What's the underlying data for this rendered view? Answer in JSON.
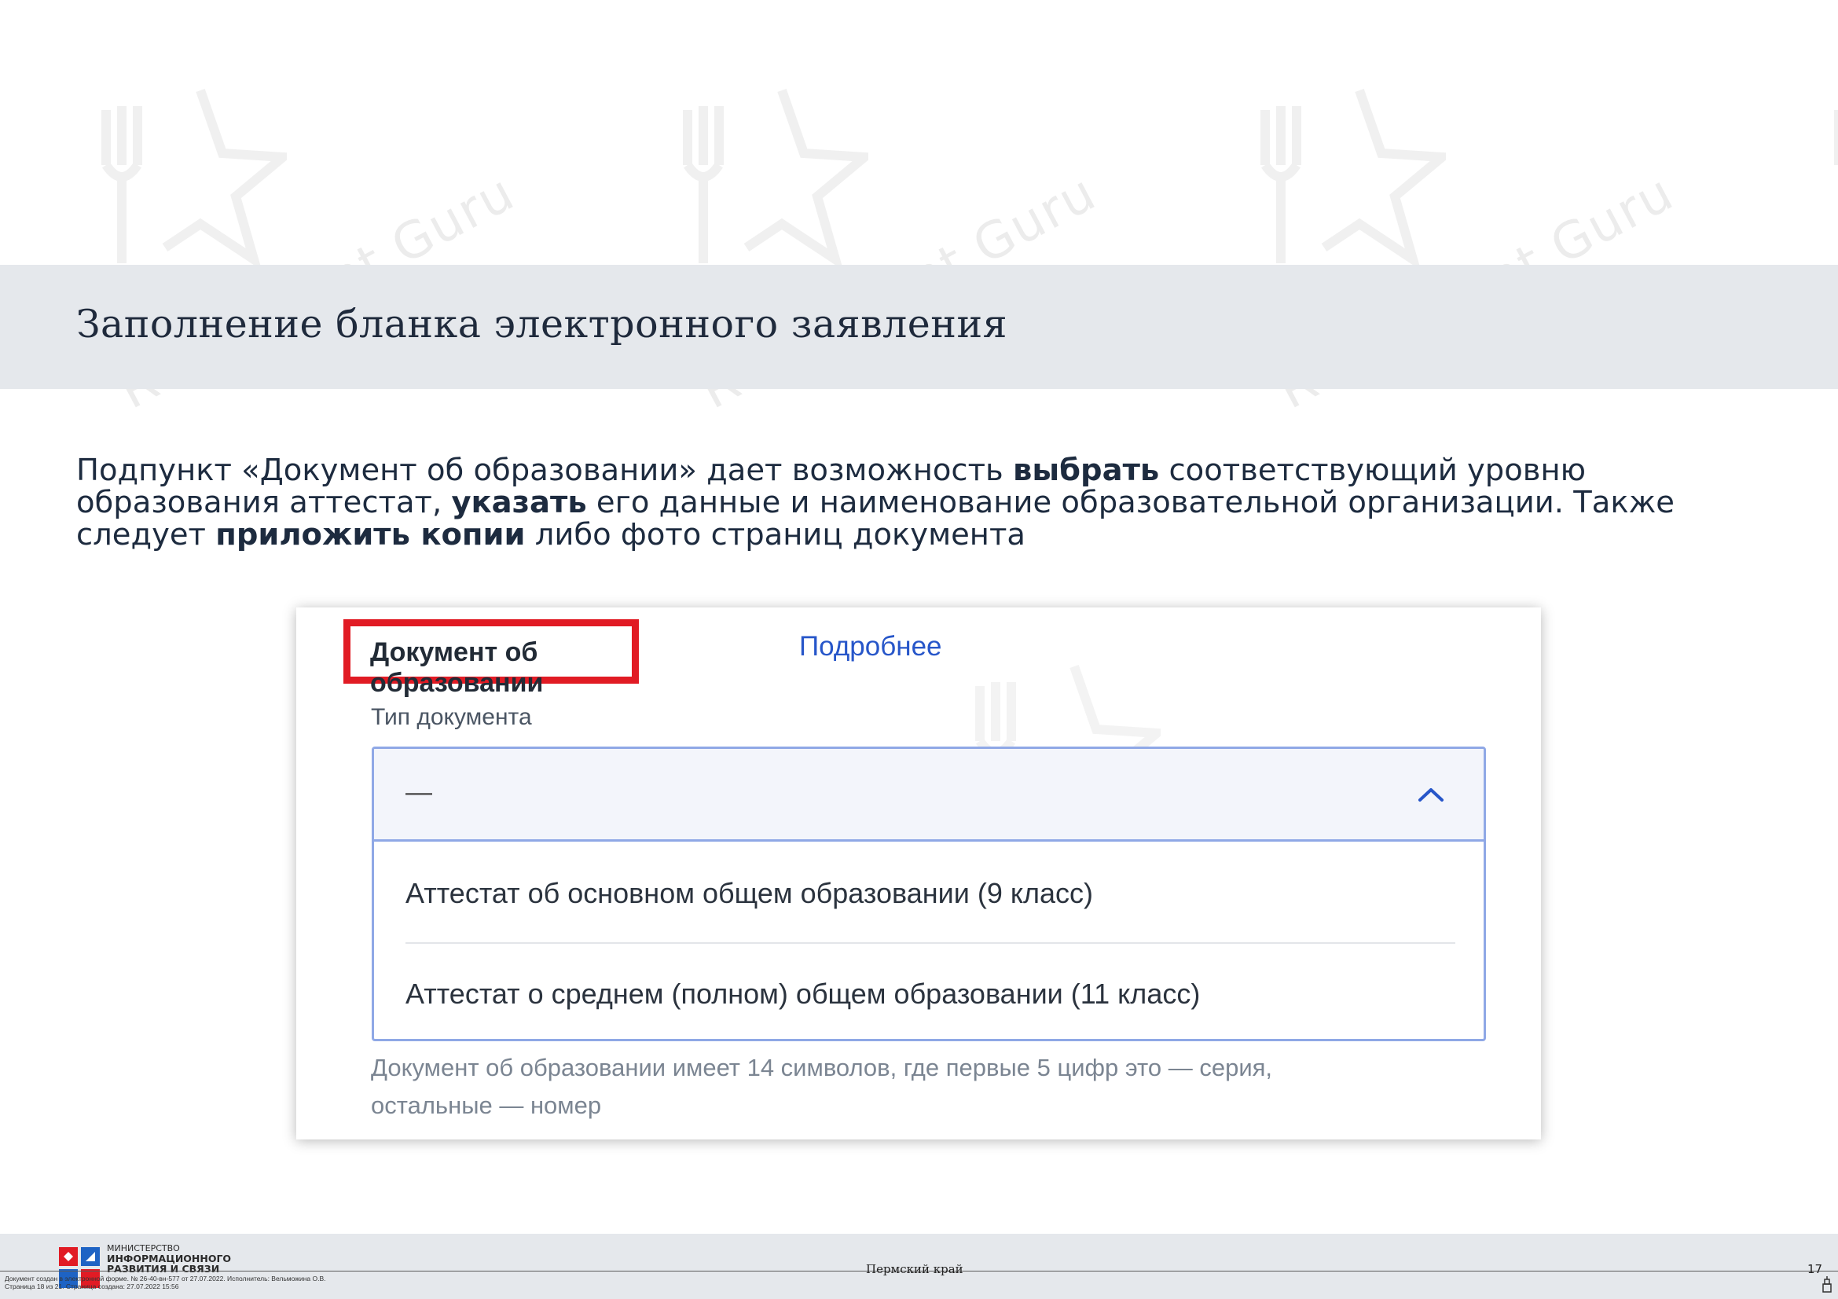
{
  "watermark": {
    "brand": "Restaurant Guru"
  },
  "title": "Заполнение бланка электронного заявления",
  "intro": {
    "line1_a": "Подпункт «Документ об образовании» дает возможность ",
    "line1_b": "выбрать",
    "line1_c": " соответствующий уровню",
    "line2_a": "образования аттестат, ",
    "line2_b": "указать",
    "line2_c": " его данные и наименование образовательной организации. Также",
    "line3_a": "следует ",
    "line3_b": "приложить копии",
    "line3_c": " либо фото страниц документа"
  },
  "form": {
    "section_title": "Документ об образовании",
    "more_link": "Подробнее",
    "field_label": "Тип документа",
    "select_value": "—",
    "options": [
      "Аттестат об основном общем образовании (9 класс)",
      "Аттестат о среднем (полном) общем образовании (11 класс)"
    ],
    "hint_line1": "Документ об образовании имеет 14 символов, где первые 5 цифр это — серия,",
    "hint_line2": "остальные — номер"
  },
  "footer": {
    "ministry_line1": "МИНИСТЕРСТВО",
    "ministry_line2": "ИНФОРМАЦИОННОГО",
    "ministry_line3": "РАЗВИТИЯ И СВЯЗИ",
    "region": "Пермский край",
    "page_number": "17",
    "doc_meta_line1": "Документ создан в электронной форме. № 26-40-вн-577 от 27.07.2022. Исполнитель: Вельможина О.В.",
    "doc_meta_line2": "Страница 18 из 21. Страница создана: 27.07.2022 15:56"
  },
  "colors": {
    "accent_red": "#e11b24",
    "link_blue": "#2756c9",
    "band_gray": "#e5e8ec",
    "select_border": "#8fa8e6"
  }
}
